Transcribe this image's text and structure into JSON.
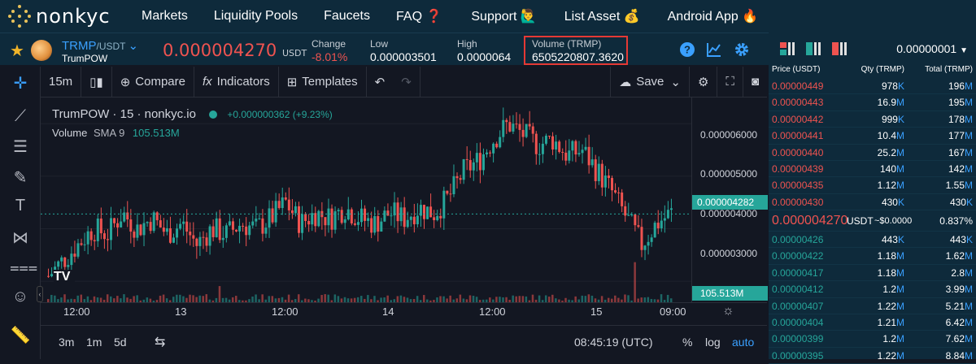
{
  "app": {
    "brand": "nonkyc"
  },
  "nav": {
    "items": [
      "Markets",
      "Liquidity Pools",
      "Faucets",
      "FAQ ❓",
      "Support 🙋‍♂️",
      "List Asset 💰",
      "Android App 🔥"
    ]
  },
  "ticker": {
    "pair_base": "TRMP",
    "pair_quote": "/USDT",
    "coin_name": "TrumPOW",
    "last_price": "0.000004270",
    "price_unit": "USDT",
    "change_label": "Change",
    "change_value": "-8.01%",
    "low_label": "Low",
    "low_value": "0.000003501",
    "high_label": "High",
    "high_value": "0.0000064",
    "volume_label": "Volume (TRMP)",
    "volume_value": "6505220807.3620"
  },
  "chart_toolbar": {
    "interval": "15m",
    "compare": "Compare",
    "indicators": "Indicators",
    "templates": "Templates",
    "save": "Save"
  },
  "chart_legend": {
    "title": "TrumPOW · 15 · nonkyc.io",
    "change": "+0.000000362 (+9.23%)",
    "volume_label": "Volume",
    "volume_sma": "SMA 9",
    "volume_value": "105.513M"
  },
  "chart_data": {
    "type": "candlestick",
    "title": "TrumPOW · 15 · nonkyc.io",
    "y_ticks": [
      "0.000006000",
      "0.000005000",
      "0.000004000",
      "0.000003000"
    ],
    "ylim": [
      2.6e-06,
      6.5e-06
    ],
    "x_ticks": [
      "12:00",
      "13",
      "12:00",
      "14",
      "12:00",
      "15",
      "09:00"
    ],
    "last_price_label": "0.000004282",
    "last_volume_label": "105.513M",
    "price_path": [
      3.1e-06,
      3.4e-06,
      3.7e-06,
      4e-06,
      3.9e-06,
      4.3e-06,
      4e-06,
      4.2e-06,
      3.9e-06,
      4.1e-06,
      3.7e-06,
      4e-06,
      3.9e-06,
      4.1e-06,
      4e-06,
      4.2e-06,
      4.5e-06,
      4.1e-06,
      4.3e-06,
      4.2e-06,
      4.4e-06,
      4.2e-06,
      4.1e-06,
      4.3e-06,
      4.2e-06,
      4.4e-06,
      4.3e-06,
      4.6e-06,
      5.1e-06,
      5.3e-06,
      5.7e-06,
      6e-06,
      5.8e-06,
      5.6e-06,
      5.7e-06,
      5.4e-06,
      5.5e-06,
      5.1e-06,
      4.7e-06,
      4.2e-06,
      3.7e-06,
      4.1e-06,
      4.3e-06
    ]
  },
  "chart_bottom": {
    "ranges": [
      "3m",
      "1m",
      "5d"
    ],
    "time": "08:45:19 (UTC)",
    "percent": "%",
    "log": "log",
    "auto": "auto"
  },
  "orderbook": {
    "precision": "0.00000001",
    "col_price": "Price (USDT)",
    "col_qty": "Qty (TRMP)",
    "col_total": "Total (TRMP)",
    "asks": [
      {
        "price": "0.00000449",
        "qty": "978",
        "qs": "K",
        "total": "196",
        "ts": "M"
      },
      {
        "price": "0.00000443",
        "qty": "16.9",
        "qs": "M",
        "total": "195",
        "ts": "M"
      },
      {
        "price": "0.00000442",
        "qty": "999",
        "qs": "K",
        "total": "178",
        "ts": "M"
      },
      {
        "price": "0.00000441",
        "qty": "10.4",
        "qs": "M",
        "total": "177",
        "ts": "M"
      },
      {
        "price": "0.00000440",
        "qty": "25.2",
        "qs": "M",
        "total": "167",
        "ts": "M"
      },
      {
        "price": "0.00000439",
        "qty": "140",
        "qs": "M",
        "total": "142",
        "ts": "M"
      },
      {
        "price": "0.00000435",
        "qty": "1.12",
        "qs": "M",
        "total": "1.55",
        "ts": "M"
      },
      {
        "price": "0.00000430",
        "qty": "430",
        "qs": "K",
        "total": "430",
        "ts": "K"
      }
    ],
    "mid_price": "0.000004270",
    "mid_unit": "USDT",
    "mid_usd": "~$0.0000",
    "mid_spread": "0.837%",
    "bids": [
      {
        "price": "0.00000426",
        "qty": "443",
        "qs": "K",
        "total": "443",
        "ts": "K"
      },
      {
        "price": "0.00000422",
        "qty": "1.18",
        "qs": "M",
        "total": "1.62",
        "ts": "M"
      },
      {
        "price": "0.00000417",
        "qty": "1.18",
        "qs": "M",
        "total": "2.8",
        "ts": "M"
      },
      {
        "price": "0.00000412",
        "qty": "1.2",
        "qs": "M",
        "total": "3.99",
        "ts": "M"
      },
      {
        "price": "0.00000407",
        "qty": "1.22",
        "qs": "M",
        "total": "5.21",
        "ts": "M"
      },
      {
        "price": "0.00000404",
        "qty": "1.21",
        "qs": "M",
        "total": "6.42",
        "ts": "M"
      },
      {
        "price": "0.00000399",
        "qty": "1.2",
        "qs": "M",
        "total": "7.62",
        "ts": "M"
      },
      {
        "price": "0.00000395",
        "qty": "1.22",
        "qs": "M",
        "total": "8.84",
        "ts": "M"
      }
    ]
  },
  "colors": {
    "up": "#26a69a",
    "down": "#ef5350",
    "accent": "#3aa0ff",
    "highlight": "#e53935"
  }
}
